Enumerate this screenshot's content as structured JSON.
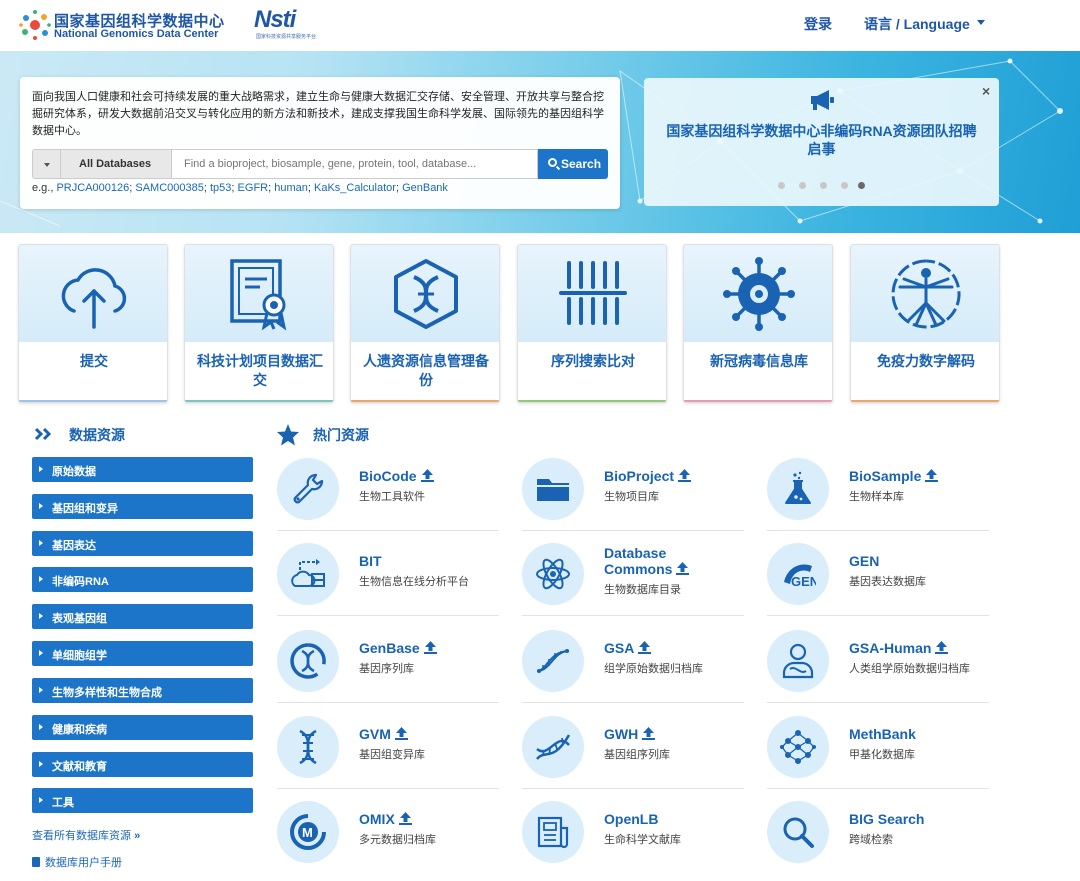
{
  "header": {
    "logo_cn": "国家基因组科学数据中心",
    "logo_en": "National Genomics Data Center",
    "nsti_logo": "Nsti",
    "nsti_sub": "国家科技资源共享服务平台",
    "login": "登录",
    "language": "语言 / Language"
  },
  "banner": {
    "intro": "面向我国人口健康和社会可持续发展的重大战略需求，建立生命与健康大数据汇交存储、安全管理、开放共享与整合挖掘研究体系，研发大数据前沿交叉与转化应用的新方法和新技术，建成支撑我国生命科学发展、国际领先的基因组科学数据中心。",
    "db_select": "All Databases",
    "search_placeholder": "Find a bioproject, biosample, gene, protein, tool, database...",
    "search_button": "Search",
    "examples_prefix": "e.g.,",
    "examples": [
      "PRJCA000126",
      "SAMC000385",
      "tp53",
      "EGFR",
      "human",
      "KaKs_Calculator",
      "GenBank"
    ],
    "notice_title": "国家基因组科学数据中心非编码RNA资源团队招聘启事",
    "notice_close": "×",
    "carousel_active_index": 4
  },
  "tiles": [
    {
      "label": "提交",
      "icon": "cloud-upload-icon",
      "accent": "#9bc4e8"
    },
    {
      "label": "科技计划项目数据汇交",
      "icon": "certificate-icon",
      "accent": "#7cc6c0"
    },
    {
      "label": "人遗资源信息管理备份",
      "icon": "dna-hexagon-icon",
      "accent": "#e7a86a"
    },
    {
      "label": "序列搜索比对",
      "icon": "sequence-alignment-icon",
      "accent": "#8fca7a"
    },
    {
      "label": "新冠病毒信息库",
      "icon": "virus-icon",
      "accent": "#e39bb7"
    },
    {
      "label": "免疫力数字解码",
      "icon": "vitruvian-man-icon",
      "accent": "#e7a86a"
    }
  ],
  "left": {
    "heading": "数据资源",
    "categories": [
      "原始数据",
      "基因组和变异",
      "基因表达",
      "非编码RNA",
      "表观基因组",
      "单细胞组学",
      "生物多样性和生物合成",
      "健康和疾病",
      "文献和教育",
      "工具"
    ],
    "view_all": "查看所有数据库资源",
    "manual": "数据库用户手册"
  },
  "hot": {
    "heading": "热门资源",
    "items": [
      {
        "name": "BioCode",
        "desc": "生物工具软件",
        "upload": true,
        "icon": "wrench-icon"
      },
      {
        "name": "BioProject",
        "desc": "生物项目库",
        "upload": true,
        "icon": "folder-icon"
      },
      {
        "name": "BioSample",
        "desc": "生物样本库",
        "upload": true,
        "icon": "flask-icon"
      },
      {
        "name": "BIT",
        "desc": "生物信息在线分析平台",
        "upload": false,
        "icon": "cloud-transfer-icon"
      },
      {
        "name": "Database Commons",
        "desc": "生物数据库目录",
        "upload": true,
        "icon": "atom-icon"
      },
      {
        "name": "GEN",
        "desc": "基因表达数据库",
        "upload": false,
        "icon": "gen-logo-icon"
      },
      {
        "name": "GenBase",
        "desc": "基因序列库",
        "upload": true,
        "icon": "genbase-logo-icon"
      },
      {
        "name": "GSA",
        "desc": "组学原始数据归档库",
        "upload": true,
        "icon": "dna-strand-icon"
      },
      {
        "name": "GSA-Human",
        "desc": "人类组学原始数据归档库",
        "upload": true,
        "icon": "person-icon"
      },
      {
        "name": "GVM",
        "desc": "基因组变异库",
        "upload": true,
        "icon": "dna-ladder-icon"
      },
      {
        "name": "GWH",
        "desc": "基因组序列库",
        "upload": true,
        "icon": "dna-helix-icon"
      },
      {
        "name": "MethBank",
        "desc": "甲基化数据库",
        "upload": false,
        "icon": "network-icon"
      },
      {
        "name": "OMIX",
        "desc": "多元数据归档库",
        "upload": true,
        "icon": "omix-logo-icon"
      },
      {
        "name": "OpenLB",
        "desc": "生命科学文献库",
        "upload": false,
        "icon": "newspaper-icon"
      },
      {
        "name": "BIG Search",
        "desc": "跨域检索",
        "upload": false,
        "icon": "magnifier-icon"
      }
    ]
  },
  "colors": {
    "primary": "#1c75c9",
    "link": "#1a63b3"
  }
}
